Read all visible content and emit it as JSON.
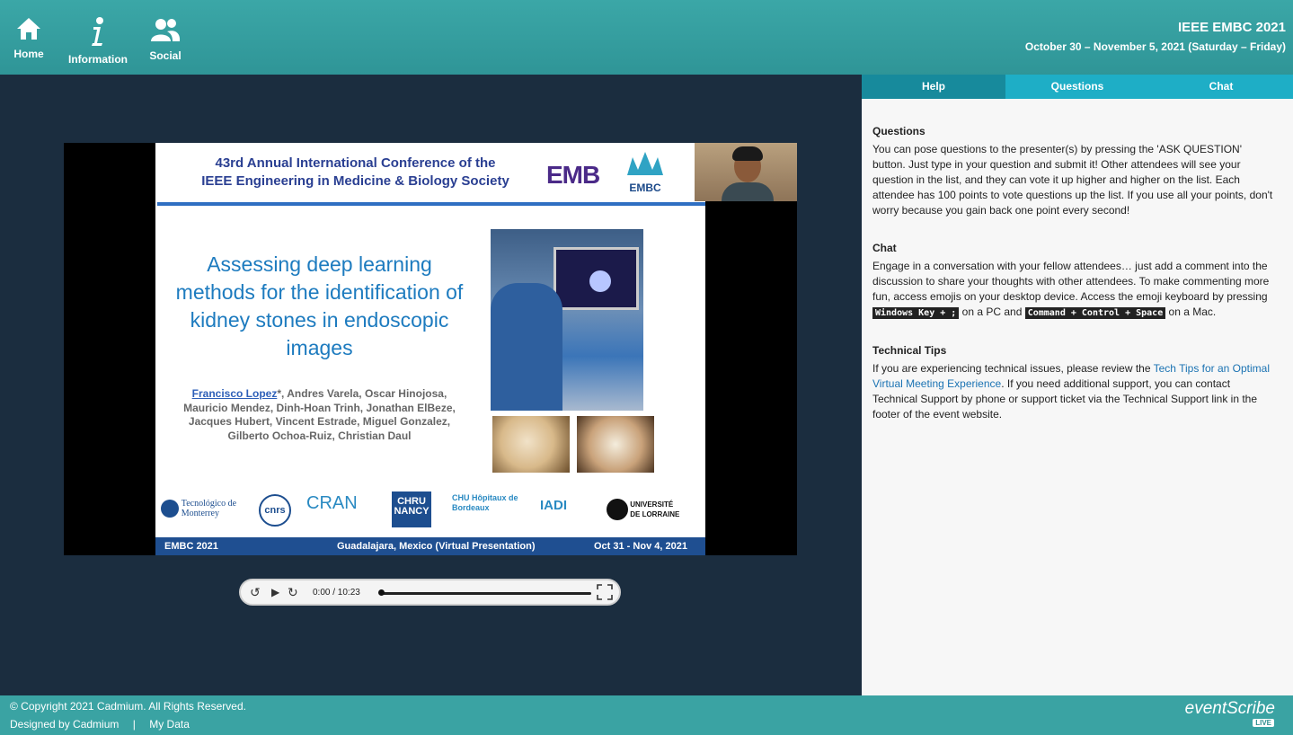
{
  "nav": {
    "home_label": "Home",
    "info_label": "Information",
    "social_label": "Social"
  },
  "event": {
    "title": "IEEE EMBC 2021",
    "dates": "October 30 – November 5, 2021 (Saturday – Friday)"
  },
  "slide": {
    "header_line1": "43rd Annual International Conference of the",
    "header_line2": "IEEE Engineering in Medicine & Biology Society",
    "emb_logo": "EMB",
    "embc_logo": "EMBC",
    "title": "Assessing deep learning methods for the identification of kidney stones in endoscopic images",
    "lead_author": "Francisco Lopez",
    "authors_rest": "*, Andres Varela, Oscar Hinojosa, Mauricio Mendez, Dinh-Hoan Trinh, Jonathan ElBeze, Jacques Hubert, Vincent Estrade, Miguel Gonzalez, Gilberto Ochoa-Ruiz, Christian Daul",
    "logos": [
      "Tecnológico de Monterrey",
      "cnrs",
      "CRAN",
      "CHRU NANCY",
      "CHU Hôpitaux de Bordeaux",
      "IADI",
      "UNIVERSITÉ DE LORRAINE"
    ],
    "footer_left": "EMBC 2021",
    "footer_center": "Guadalajara, Mexico (Virtual Presentation)",
    "footer_right": "Oct 31 - Nov 4, 2021"
  },
  "player": {
    "time": "0:00  /  10:23",
    "progress": 0.0
  },
  "side": {
    "tabs": [
      "Help",
      "Questions",
      "Chat"
    ],
    "active_tab": "Help",
    "questions_heading": "Questions",
    "questions_text": "You can pose questions to the presenter(s) by pressing the 'ASK QUESTION' button. Just type in your question and submit it! Other attendees will see your question in the list, and they can vote it up higher and higher on the list. Each attendee has 100 points to vote questions up the list. If you use all your points, don't worry because you gain back one point every second!",
    "chat_heading": "Chat",
    "chat_text_1": "Engage in a conversation with your fellow attendees… just add a comment into the discussion to share your thoughts with other attendees. To make commenting more fun, access emojis on your desktop device. Access the emoji keyboard by pressing ",
    "chat_key_pc": "Windows Key + ;",
    "chat_text_2": " on a PC and ",
    "chat_key_mac": "Command + Control + Space",
    "chat_text_3": " on a Mac.",
    "tech_heading": "Technical Tips",
    "tech_text_1": "If you are experiencing technical issues, please review the ",
    "tech_link": "Tech Tips for an Optimal Virtual Meeting Experience",
    "tech_text_2": ". If you need additional support, you can contact Technical Support by phone or support ticket via the Technical Support link in the footer of the event website."
  },
  "footer": {
    "copyright": "© Copyright 2021 Cadmium. All Rights Reserved.",
    "designed_by": "Designed by Cadmium",
    "separator": "|",
    "my_data": "My Data",
    "brand": "eventScribe",
    "live": "LIVE"
  },
  "colors": {
    "header_teal": "#3ba7a7",
    "tab_blue": "#1eaec6",
    "tab_active": "#178a9c",
    "stage_bg": "#1b2d3f"
  }
}
